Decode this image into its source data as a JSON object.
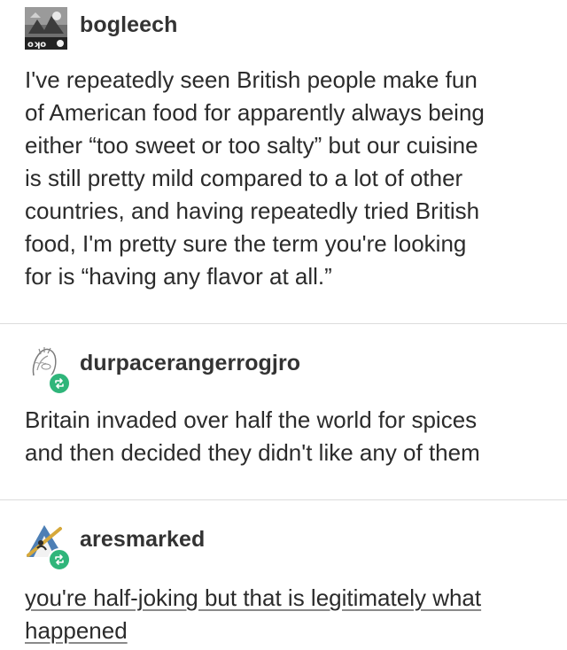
{
  "posts": [
    {
      "username": "bogleech",
      "avatar_icon": "photo-avatar-icon",
      "reblog": false,
      "lines": [
        "I've repeatedly seen British people make fun",
        "of American food for apparently always being",
        "either “too sweet or too salty” but our cuisine",
        "is still pretty mild compared to a lot of other",
        "countries, and having repeatedly tried British",
        "food, I'm pretty sure the term you're looking",
        "for is “having any flavor at all.”"
      ]
    },
    {
      "username": "durpacerangerrogjro",
      "avatar_icon": "sketch-avatar-icon",
      "reblog": true,
      "lines": [
        "Britain invaded over half the world for spices",
        "and then decided they didn't like any of them"
      ]
    },
    {
      "username": "aresmarked",
      "avatar_icon": "illustration-avatar-icon",
      "reblog": true,
      "underlined": true,
      "lines": [
        "you're half-joking but that is legitimately what",
        "happened"
      ]
    }
  ],
  "colors": {
    "text": "#2b2b2b",
    "divider": "#dcdcdc",
    "reblog_badge": "#2fb57a"
  }
}
